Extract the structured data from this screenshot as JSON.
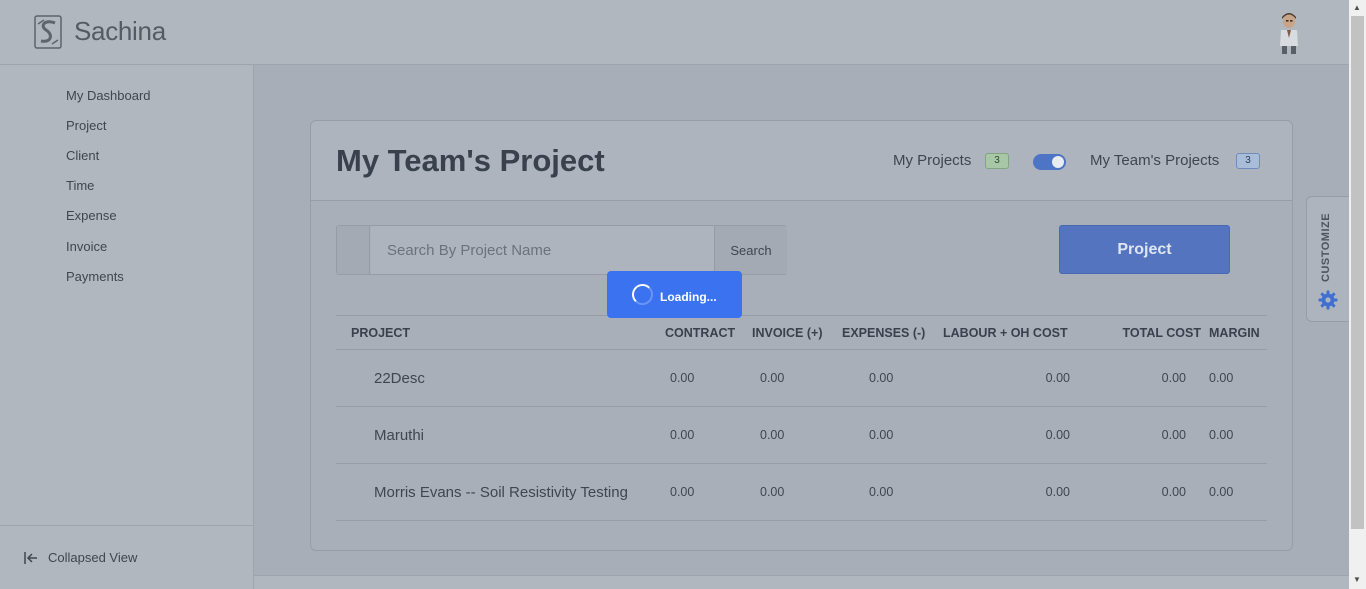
{
  "header": {
    "brand": "Sachina",
    "logo_icon": "sachina-logo-icon",
    "avatar_icon": "user-avatar-icon"
  },
  "sidebar": {
    "items": [
      {
        "label": "My Dashboard"
      },
      {
        "label": "Project"
      },
      {
        "label": "Client"
      },
      {
        "label": "Time"
      },
      {
        "label": "Expense"
      },
      {
        "label": "Invoice"
      },
      {
        "label": "Payments"
      }
    ],
    "collapse_icon": "collapse-left-icon",
    "collapse_label": "Collapsed View"
  },
  "main": {
    "title": "My Team's Project",
    "my_projects_label": "My Projects",
    "my_projects_count": "3",
    "team_projects_label": "My Team's Projects",
    "team_projects_count": "3",
    "toggle_on": true,
    "search": {
      "placeholder": "Search By Project Name",
      "value": "",
      "button_label": "Search"
    },
    "new_project_label": "Project",
    "loading_text": "Loading...",
    "table": {
      "columns": [
        "PROJECT",
        "CONTRACT",
        "INVOICE (+)",
        "EXPENSES (-)",
        "LABOUR + OH COST",
        "TOTAL COST",
        "MARGIN"
      ],
      "rows": [
        {
          "project": "22Desc",
          "contract": "0.00",
          "invoice": "0.00",
          "expenses": "0.00",
          "labour": "0.00",
          "total": "0.00",
          "margin": "0.00"
        },
        {
          "project": "Maruthi",
          "contract": "0.00",
          "invoice": "0.00",
          "expenses": "0.00",
          "labour": "0.00",
          "total": "0.00",
          "margin": "0.00"
        },
        {
          "project": "Morris Evans -- Soil Resistivity Testing",
          "contract": "0.00",
          "invoice": "0.00",
          "expenses": "0.00",
          "labour": "0.00",
          "total": "0.00",
          "margin": "0.00"
        }
      ]
    }
  },
  "customize": {
    "label": "CUSTOMIZE",
    "icon": "gear-icon"
  },
  "colors": {
    "accent": "#5474c0",
    "loading_bg": "#3a72f0",
    "badge_green": "#a8c7a6",
    "badge_blue": "#a9bdd8"
  }
}
